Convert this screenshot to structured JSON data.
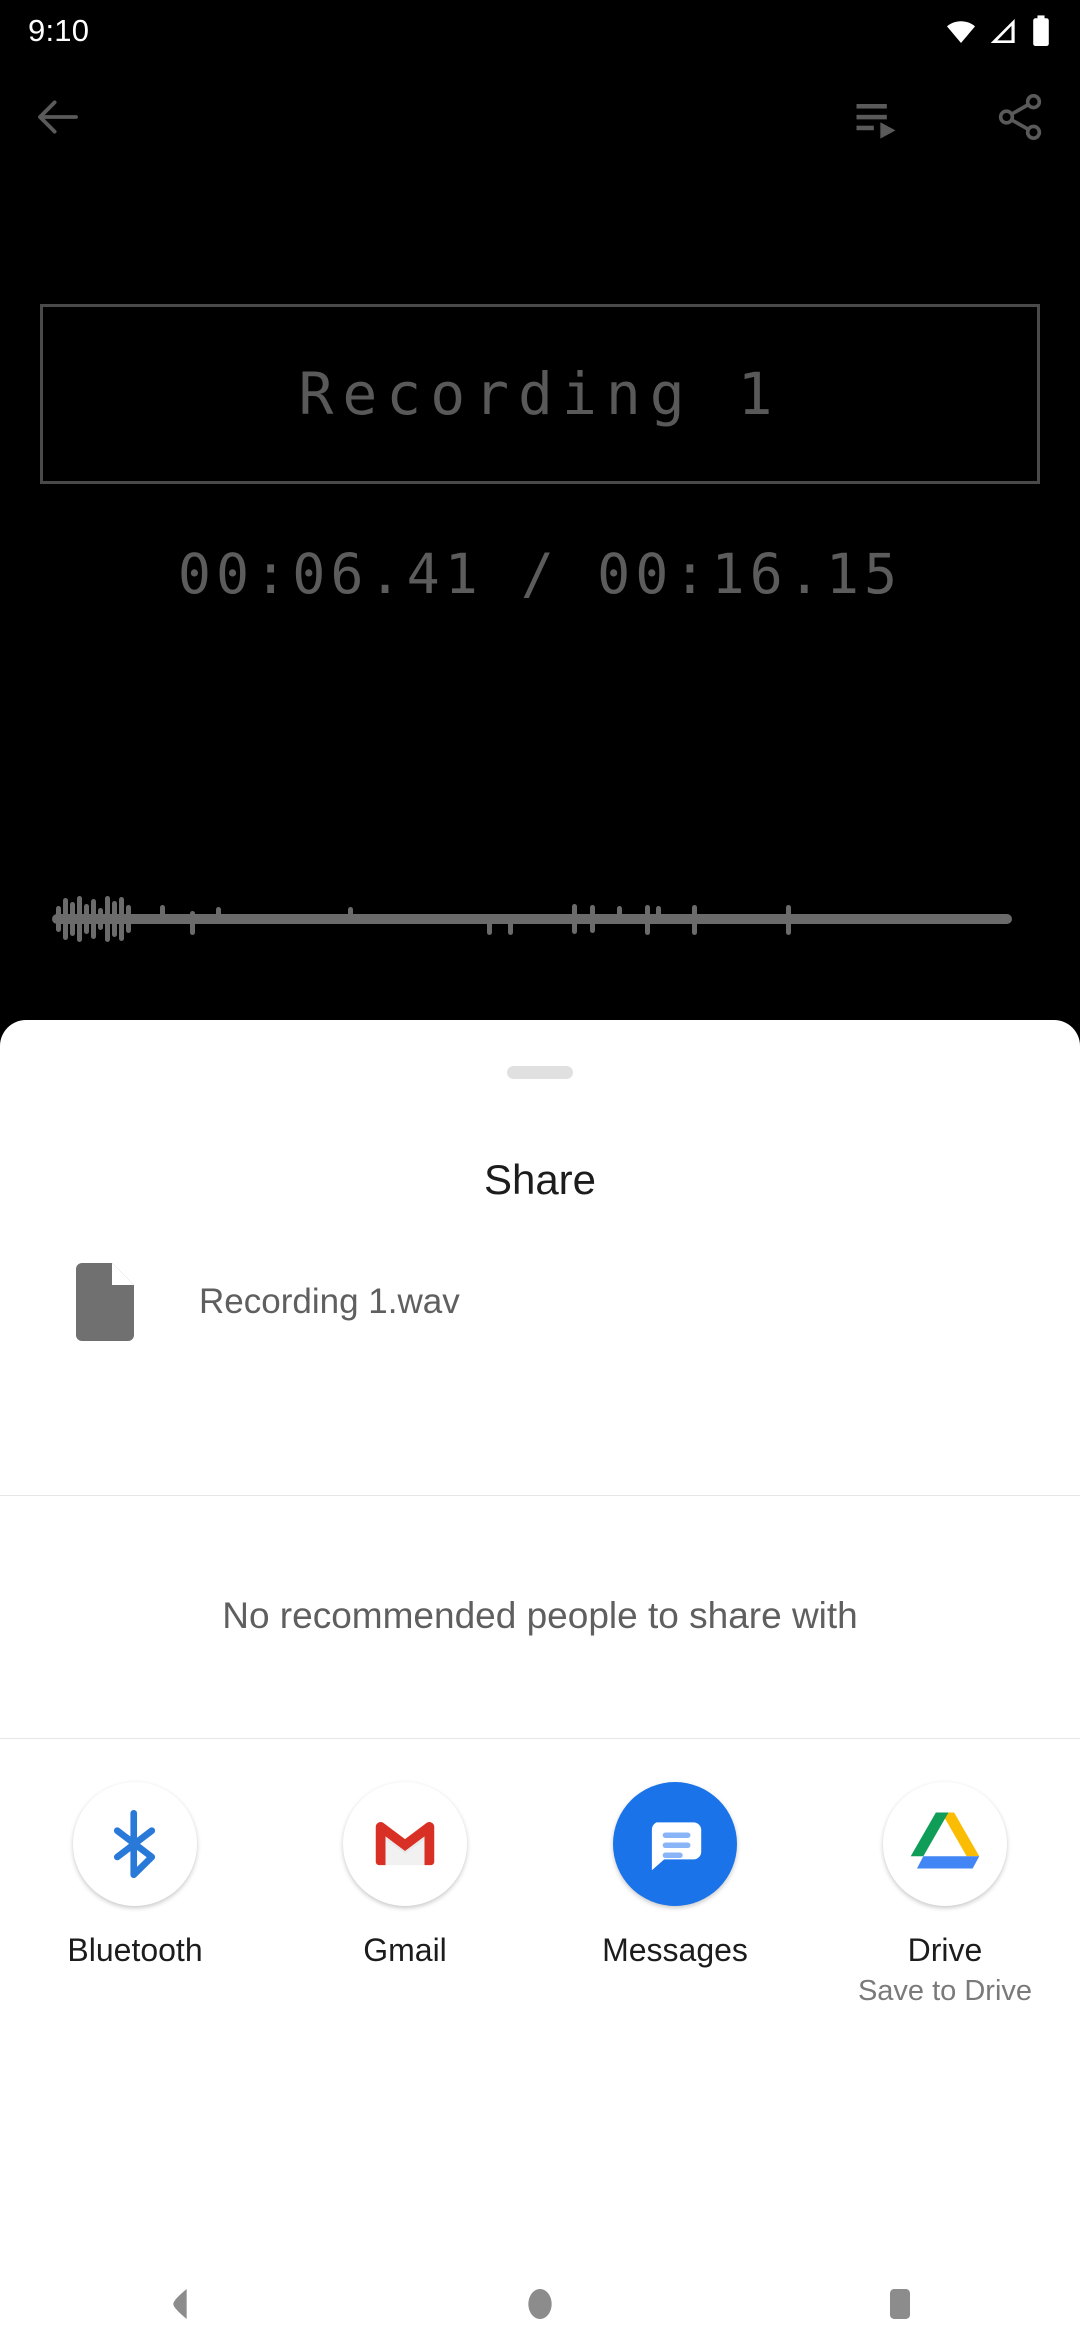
{
  "status_bar": {
    "time": "9:10",
    "icons": [
      "wifi-icon",
      "cellular-signal-icon",
      "battery-icon"
    ]
  },
  "app_toolbar": {
    "back_icon": "arrow-back-icon",
    "playlist_icon": "playlist-play-icon",
    "share_icon": "share-icon"
  },
  "player": {
    "recording_title": "Recording 1",
    "timer": "00:06.41 / 00:16.15",
    "current_position": "00:06.41",
    "total_duration": "00:16.15",
    "waveform_label": "audio-waveform"
  },
  "share_sheet": {
    "title": "Share",
    "file": {
      "icon": "file-document-icon",
      "name": "Recording 1.wav"
    },
    "empty_people_message": "No recommended people to share with",
    "targets": [
      {
        "label": "Bluetooth",
        "sublabel": "",
        "icon": "bluetooth-icon",
        "color": "#2979D9"
      },
      {
        "label": "Gmail",
        "sublabel": "",
        "icon": "gmail-icon",
        "color": "#D93025"
      },
      {
        "label": "Messages",
        "sublabel": "",
        "icon": "messages-icon",
        "color": "#1A73E8"
      },
      {
        "label": "Drive",
        "sublabel": "Save to Drive",
        "icon": "drive-icon",
        "color": "#FBBC04"
      }
    ]
  },
  "nav_bar": {
    "back": "nav-back-icon",
    "home": "nav-home-icon",
    "recents": "nav-recents-icon"
  },
  "colors": {
    "background": "#000000",
    "sheet": "#FFFFFF",
    "dim_text": "#5C5C5C",
    "body_text": "#5F5F5F",
    "title_text": "#1C1C1C"
  }
}
